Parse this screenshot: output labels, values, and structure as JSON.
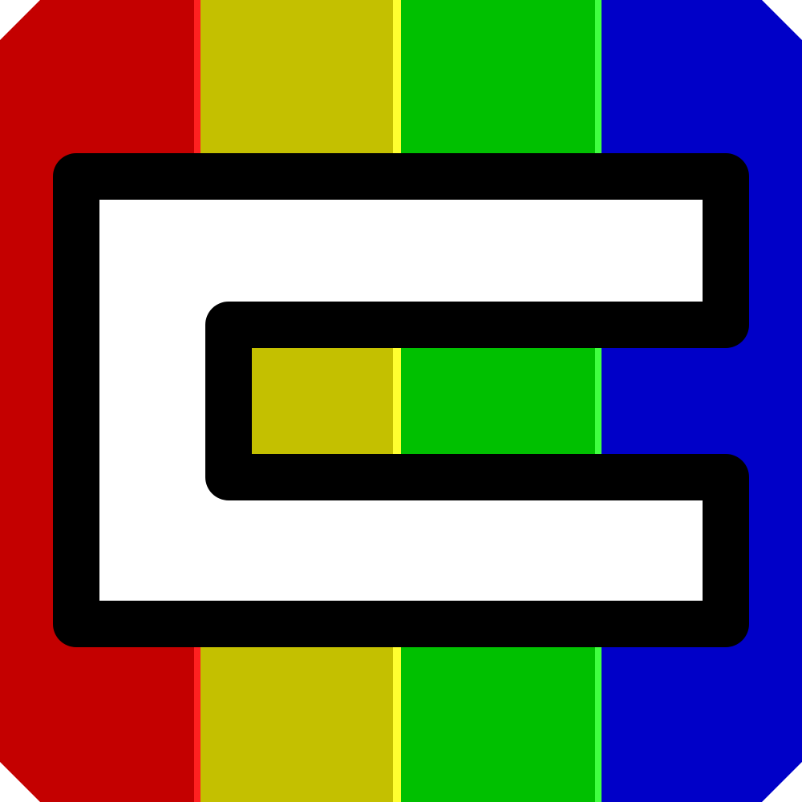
{
  "icon": {
    "name": "rainbow-letter-e-app-icon",
    "stripe_colors": [
      "#c40000",
      "#c4c000",
      "#00c000",
      "#0000c8"
    ],
    "stripe_highlight_colors": [
      "#ff2020",
      "#ffff30",
      "#40ff40",
      "#3030ff"
    ],
    "letter_fill": "#ffffff",
    "letter_outline": "#000000",
    "background": "#ffffff"
  }
}
